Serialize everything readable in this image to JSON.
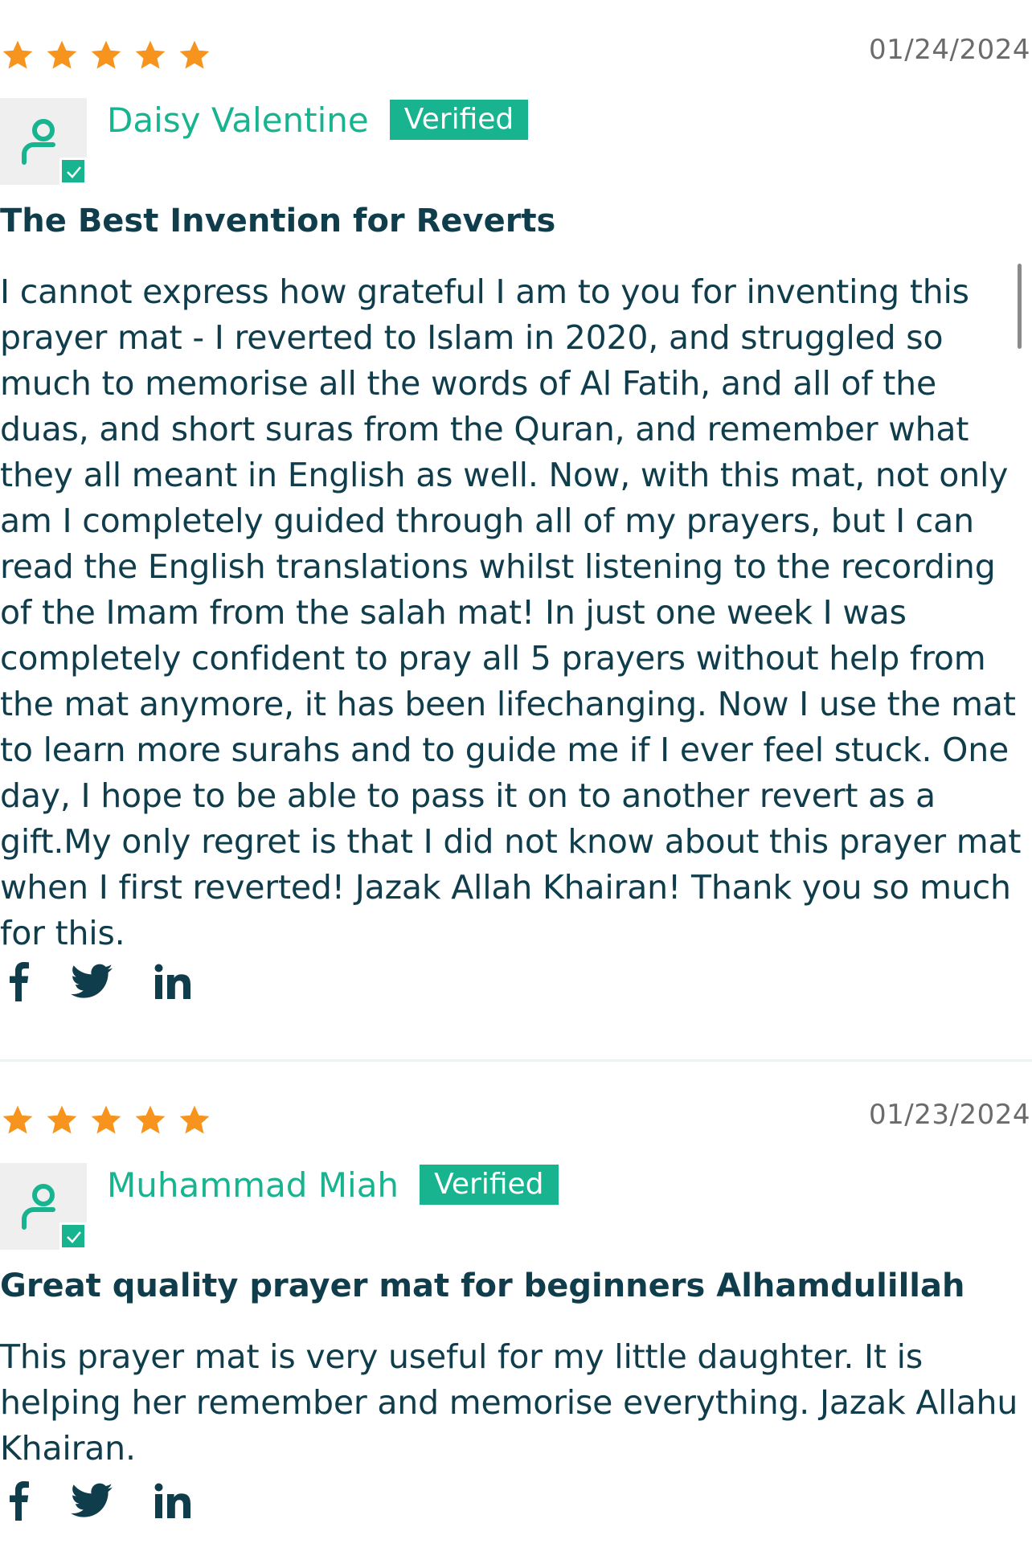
{
  "colors": {
    "accent": "#17b48f",
    "star": "#f7941d",
    "text": "#0f3d4c",
    "date": "#6b6b6b"
  },
  "reviews": [
    {
      "rating": 5,
      "date": "01/24/2024",
      "author": "Daisy Valentine",
      "badge": "Verified",
      "title": "The Best Invention for Reverts",
      "body": "I cannot express how grateful I am to you for inventing this prayer mat - I reverted to Islam in 2020, and struggled so much to memorise all the words of Al Fatih, and all of the duas, and short suras from the Quran, and remember what they all meant in English as well. Now, with this mat, not only am I completely guided through all of my prayers, but I can read the English translations whilst listening to the recording of the Imam from the salah mat! In just one week I was completely confident to pray all 5 prayers without help from the mat anymore, it has been lifechanging. Now I use the mat to learn more surahs and to guide me if I ever feel stuck. One day, I hope to be able to pass it on to another revert as a gift.My only regret is that I did not know about this prayer mat when I first reverted! Jazak Allah Khairan! Thank you so much for this.",
      "share_icons": [
        "facebook-icon",
        "twitter-icon",
        "linkedin-icon"
      ]
    },
    {
      "rating": 5,
      "date": "01/23/2024",
      "author": "Muhammad Miah",
      "badge": "Verified",
      "title": "Great quality prayer mat for beginners Alhamdulillah",
      "body": "This prayer mat is very useful for my little daughter. It is helping her remember and memorise everything. Jazak Allahu Khairan.",
      "share_icons": [
        "facebook-icon",
        "twitter-icon",
        "linkedin-icon"
      ]
    }
  ]
}
